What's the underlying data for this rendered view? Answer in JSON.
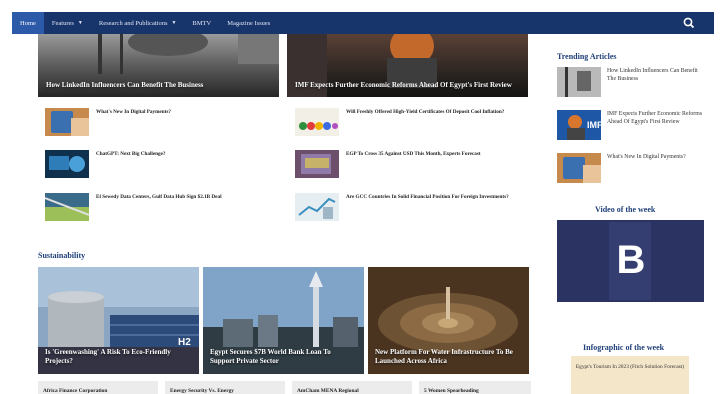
{
  "nav": {
    "items": [
      {
        "label": "Home",
        "active": true
      },
      {
        "label": "Features",
        "dropdown": true
      },
      {
        "label": "Research and Publications",
        "dropdown": true
      },
      {
        "label": "BMTV"
      },
      {
        "label": "Magazine Issues"
      }
    ],
    "search_icon": "search-icon"
  },
  "hero": [
    {
      "title": "How LinkedIn Influencers Can Benefit The Business"
    },
    {
      "title": "IMF Expects Further Economic Reforms Ahead Of Egypt's First Review"
    }
  ],
  "mini_articles": [
    {
      "title": "What's New In Digital Payments?"
    },
    {
      "title": "Will Freshly Offered High-Yield Certificates Of Deposit Cool Inflation?"
    },
    {
      "title": "ChatGPT: Next Big Challenge?"
    },
    {
      "title": "EGP To Cross 35 Against USD This Month, Experts Forecast"
    },
    {
      "title": "El Sewedy Data Centers, Gulf Data Hub Sign $2.1B Deal"
    },
    {
      "title": "Are GCC Countries In Solid Financial Position For Foreign Investments?"
    }
  ],
  "sidebar": {
    "trending_title": "Trending Articles",
    "trending": [
      {
        "title": "How LinkedIn Influencers Can Benefit The Business"
      },
      {
        "title": "IMF Expects Further Economic Reforms Ahead Of Egypt's First Review"
      },
      {
        "title": "What's New In Digital Payments?"
      }
    ],
    "video_title": "Video of the week",
    "video_letter": "B",
    "infographic_title": "Infographic of the week",
    "infographic_caption": "Egypt's Tourism In 2023 (Fitch Solution Forecast)"
  },
  "sustainability": {
    "title": "Sustainability",
    "cards": [
      {
        "title": "Is 'Greenwashing' A Risk To Eco-Friendly Projects?",
        "label": "H2"
      },
      {
        "title": "Egypt Secures $7B World Bank Loan To Support Private Sector"
      },
      {
        "title": "New Platform For Water Infrastructure To Be Launched Across Africa"
      }
    ],
    "tiles": [
      {
        "title": "Africa Finance Corporation"
      },
      {
        "title": "Energy Security Vs. Energy"
      },
      {
        "title": "AmCham MENA Regional"
      },
      {
        "title": "5 Women Spearheading"
      }
    ]
  },
  "colors": {
    "nav_bg": "#18356b",
    "nav_active": "#2d5aa8",
    "heading": "#20407a"
  }
}
